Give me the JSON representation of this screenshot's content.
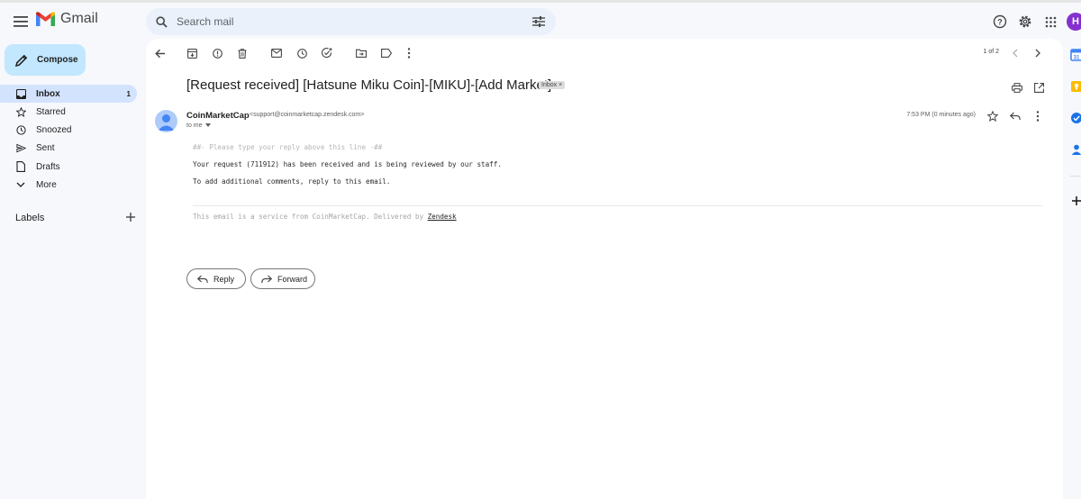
{
  "header": {
    "app_name": "Gmail",
    "search_placeholder": "Search mail",
    "avatar_initial": "H"
  },
  "sidebar": {
    "compose_label": "Compose",
    "items": [
      {
        "label": "Inbox",
        "count": "1",
        "icon": "inbox-icon",
        "active": true
      },
      {
        "label": "Starred",
        "icon": "star-icon"
      },
      {
        "label": "Snoozed",
        "icon": "clock-icon"
      },
      {
        "label": "Sent",
        "icon": "send-icon"
      },
      {
        "label": "Drafts",
        "icon": "file-icon"
      },
      {
        "label": "More",
        "icon": "chevron-down-icon"
      }
    ],
    "labels_title": "Labels"
  },
  "toolbar": {
    "pager": "1 of 2"
  },
  "email": {
    "subject": "[Request received] [Hatsune Miku Coin]-[MIKU]-[Add Market]",
    "badge": "Inbox",
    "sender_name": "CoinMarketCap",
    "sender_email": "<support@coinmarketcap.zendesk.com>",
    "to_line": "to me",
    "timestamp": "7:53 PM (0 minutes ago)",
    "body": {
      "line1": "##- Please type your reply above this line -##",
      "line2": "Your request (711912) has been received and is being reviewed by our staff.",
      "line3": "To add additional comments, reply to this email."
    },
    "footer_prefix": "This email is a service from CoinMarketCap. Delivered by ",
    "footer_link": "Zendesk"
  },
  "actions": {
    "reply_label": "Reply",
    "forward_label": "Forward"
  },
  "colors": {
    "background": "#f6f8fc",
    "compose": "#c2e7ff",
    "active_nav": "#d3e3fd",
    "search": "#eaf1fb",
    "avatar": "#8430ce"
  }
}
